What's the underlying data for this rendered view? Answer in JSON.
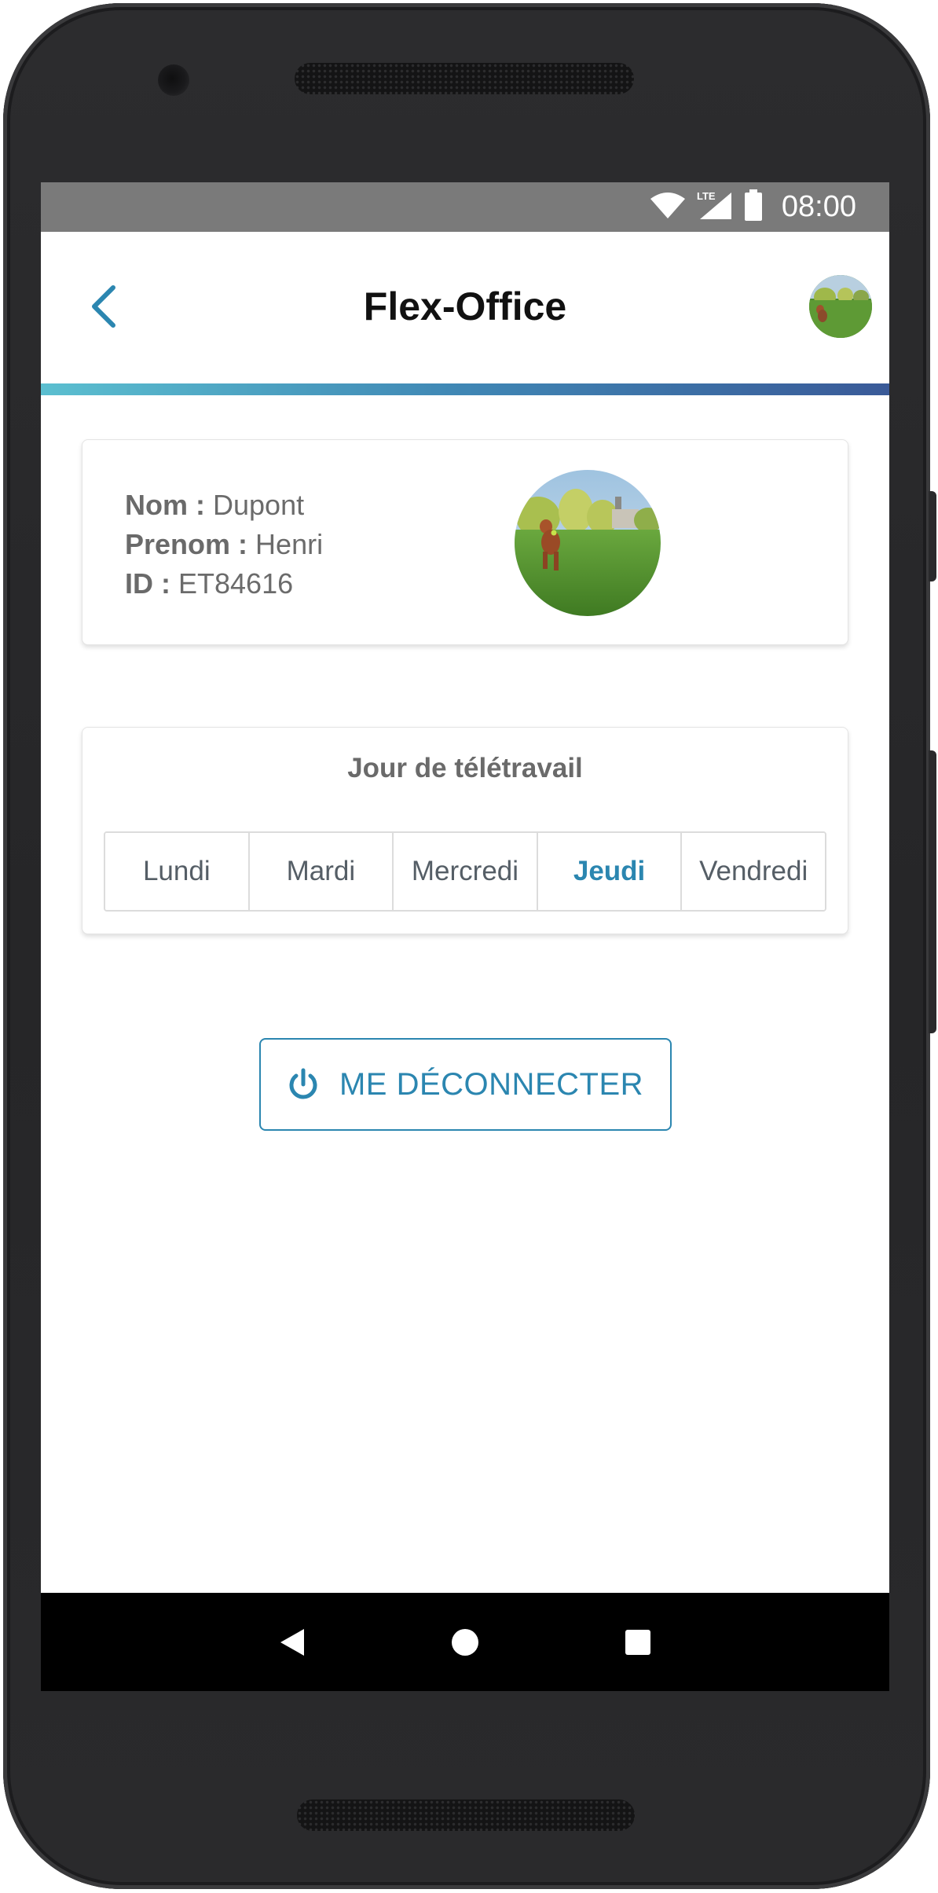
{
  "device": {
    "frame_color": "#2c2c2e"
  },
  "status_bar": {
    "time": "08:00",
    "network": "LTE",
    "icons": [
      "wifi-icon",
      "cellular-signal-icon",
      "battery-icon"
    ],
    "background": "#7a7a7a"
  },
  "app_bar": {
    "title": "Flex-Office",
    "back_icon": "chevron-left-icon",
    "avatar_icon": "profile-avatar",
    "accent": "#2b86b0"
  },
  "profile": {
    "nom_label": "Nom :",
    "nom_value": "Dupont",
    "prenom_label": "Prenom :",
    "prenom_value": "Henri",
    "id_label": "ID :",
    "id_value": "ET84616",
    "photo": "dog-in-park-photo"
  },
  "telework": {
    "title": "Jour de télétravail",
    "days": [
      {
        "label": "Lundi",
        "selected": false
      },
      {
        "label": "Mardi",
        "selected": false
      },
      {
        "label": "Mercredi",
        "selected": false
      },
      {
        "label": "Jeudi",
        "selected": true
      },
      {
        "label": "Vendredi",
        "selected": false
      }
    ]
  },
  "logout": {
    "label": "ME DÉCONNECTER",
    "icon": "power-icon"
  },
  "nav_bar": {
    "items": [
      "back-triangle-icon",
      "home-circle-icon",
      "recents-square-icon"
    ]
  },
  "colors": {
    "accent": "#2b86b0",
    "gradient_start": "#5bbfd0",
    "gradient_end": "#3a5a98"
  }
}
